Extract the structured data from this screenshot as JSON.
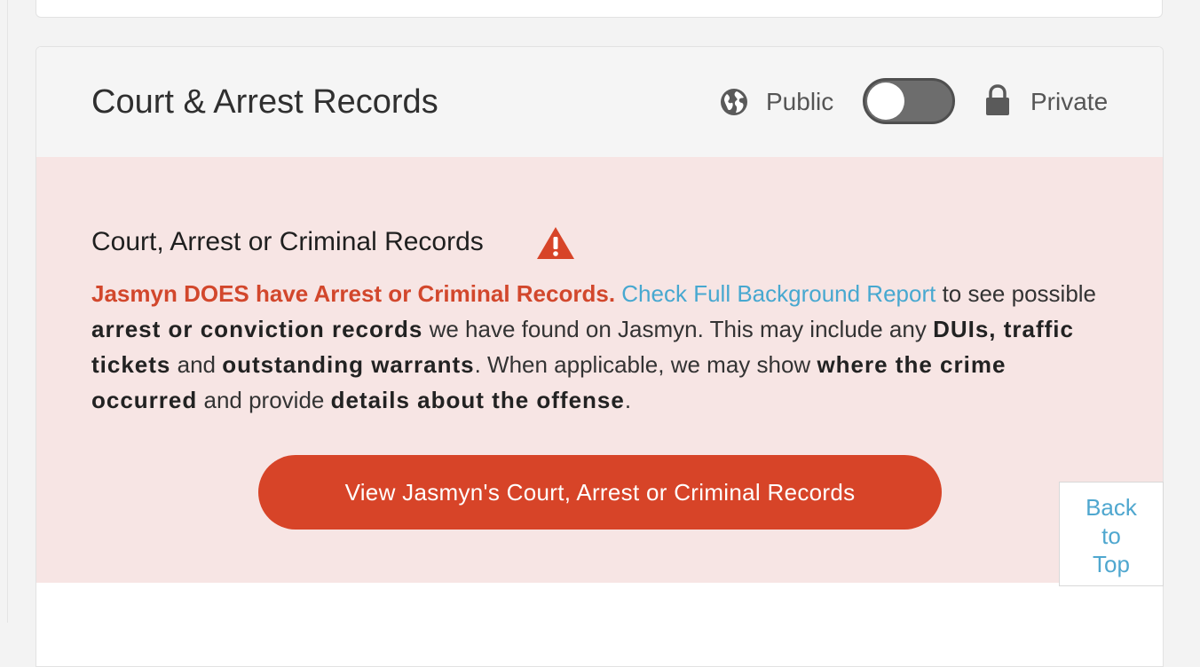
{
  "section": {
    "title": "Court & Arrest Records",
    "visibility": {
      "public_label": "Public",
      "private_label": "Private",
      "toggle_state": "public"
    }
  },
  "alert": {
    "heading": "Court, Arrest or Criminal Records",
    "warning_icon": "warning-triangle",
    "body": {
      "strong_statement": "Jasmyn DOES have Arrest or Criminal Records.",
      "link_text": "Check Full Background Report",
      "text_1": " to see possible ",
      "bold_1": "arrest or conviction records",
      "text_2": " we have found on Jasmyn. This may include any ",
      "bold_2": "DUIs, traffic tickets",
      "text_3": " and ",
      "bold_3": "outstanding warrants",
      "text_4": ". When applicable, we may show ",
      "bold_4": "where the crime occurred",
      "text_5": " and provide ",
      "bold_5": "details about the offense",
      "text_6": "."
    },
    "cta_label": "View Jasmyn's Court, Arrest or Criminal Records"
  },
  "back_to_top": {
    "line1": "Back",
    "line2": "to",
    "line3": "Top"
  },
  "colors": {
    "accent_red": "#d74428",
    "link_blue": "#47a8d0",
    "alert_background": "#f7e5e4",
    "header_background": "#f5f5f5"
  }
}
